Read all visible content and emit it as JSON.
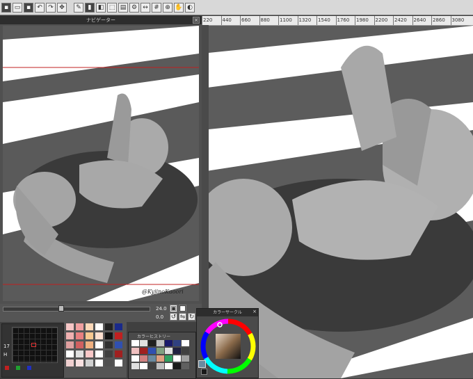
{
  "toolbar": {
    "icons": [
      "new-file-icon",
      "open-file-icon",
      "save-icon",
      "undo-icon",
      "redo-icon",
      "transform-icon",
      "pen-icon",
      "brush-icon",
      "eraser-icon",
      "select-icon",
      "layer-icon",
      "gear-icon",
      "ruler-icon",
      "grid-icon",
      "zoom-icon",
      "hand-icon",
      "fill-icon"
    ]
  },
  "navigator": {
    "title": "ナビゲーター",
    "close_label": "×",
    "signature": "@KyjinoKaoori"
  },
  "ruler": {
    "ticks": [
      "220",
      "440",
      "660",
      "880",
      "1100",
      "1320",
      "1540",
      "1760",
      "1980",
      "2200",
      "2420",
      "2640",
      "2860",
      "3080"
    ]
  },
  "canvas_toolbar": {
    "title": "",
    "minimize": "–",
    "close": "×"
  },
  "bottom": {
    "zoom_value": "24.0",
    "rotation_value": "0.0",
    "size_h_label": "H",
    "size_value": "17"
  },
  "color_circle": {
    "title": "カラーサークル",
    "close_label": "×",
    "accent_colors": [
      "#ff0000",
      "#ffff00",
      "#00ff00",
      "#00ffff",
      "#0000ff",
      "#ff00ff"
    ]
  },
  "color_history": {
    "title": "カラーヒストリー"
  },
  "colors": {
    "panel_bg": "#404040",
    "title_bg": "#2d2d2d",
    "red_line": "#c02020"
  }
}
